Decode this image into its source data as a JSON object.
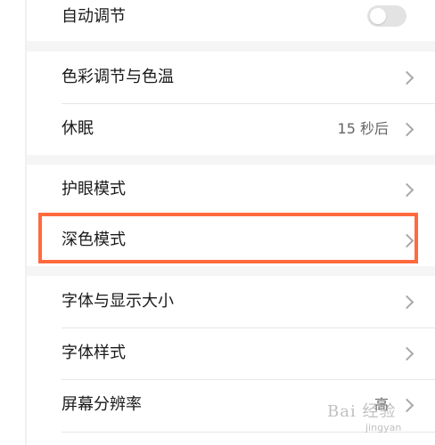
{
  "settings": {
    "auto_adjust": {
      "label": "自动调节",
      "enabled": false
    },
    "color_temp": {
      "label": "色彩调节与色温"
    },
    "sleep": {
      "label": "休眠",
      "value": "15 秒后"
    },
    "eye_care": {
      "label": "护眼模式"
    },
    "dark_mode": {
      "label": "深色模式"
    },
    "font_size": {
      "label": "字体与显示大小"
    },
    "font_style": {
      "label": "字体样式"
    },
    "resolution": {
      "label": "屏幕分辨率",
      "value": "高"
    }
  },
  "watermark": {
    "text": "Bai 经验",
    "sub": "jingyan"
  },
  "colors": {
    "highlight": "#ff6a3d",
    "toggle_off": "#e3e3e3",
    "chevron": "#a8a8a8"
  }
}
